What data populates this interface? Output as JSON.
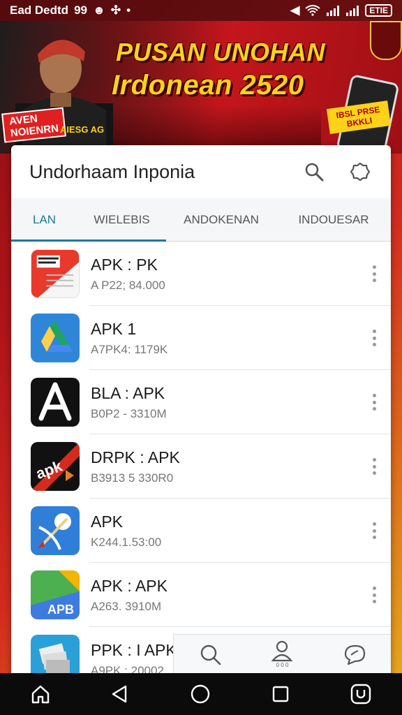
{
  "status_bar": {
    "left_text": "Ead Dedtd",
    "left_extra": "99",
    "battery_text": "ETIE"
  },
  "banner": {
    "headline_1": "PUSAN UNOHAN",
    "headline_2": "Irdonean 2520",
    "tag_1": "AVEN",
    "tag_2": "NOIENRN",
    "tag_3": "AIESG AG",
    "promo_tag": "IBSL PRSE BKKLI",
    "accent_color": "#ffd21a"
  },
  "card": {
    "title": "Undorhaam Inponia",
    "tabs": [
      {
        "label": "LAN",
        "active": true
      },
      {
        "label": "WIELEBIS",
        "active": false
      },
      {
        "label": "ANDOKENAN",
        "active": false
      },
      {
        "label": "INDOUESAR",
        "active": false
      }
    ],
    "apps": [
      {
        "name": "APK : PK",
        "sub": "A P22; 84.000",
        "icon": "document-icon"
      },
      {
        "name": "APK 1",
        "sub": "A7PK4: 1179K",
        "icon": "drive-icon"
      },
      {
        "name": "BLA : APK",
        "sub": "B0P2 - 3310M",
        "icon": "app-store-icon"
      },
      {
        "name": "DRPK : APK",
        "sub": "B3913 5 330R0",
        "icon": "apk-logo-icon"
      },
      {
        "name": "APK",
        "sub": "K244.1.53:00",
        "icon": "bow-arrow-icon"
      },
      {
        "name": "APK : APK",
        "sub": "A263. 3910M",
        "icon": "apb-icon"
      },
      {
        "name": "PPK : I APK",
        "sub": "A9PK : 20002",
        "icon": "files-stack-icon"
      }
    ]
  },
  "bottom_bar": {
    "profile_label": "0 0 0"
  }
}
